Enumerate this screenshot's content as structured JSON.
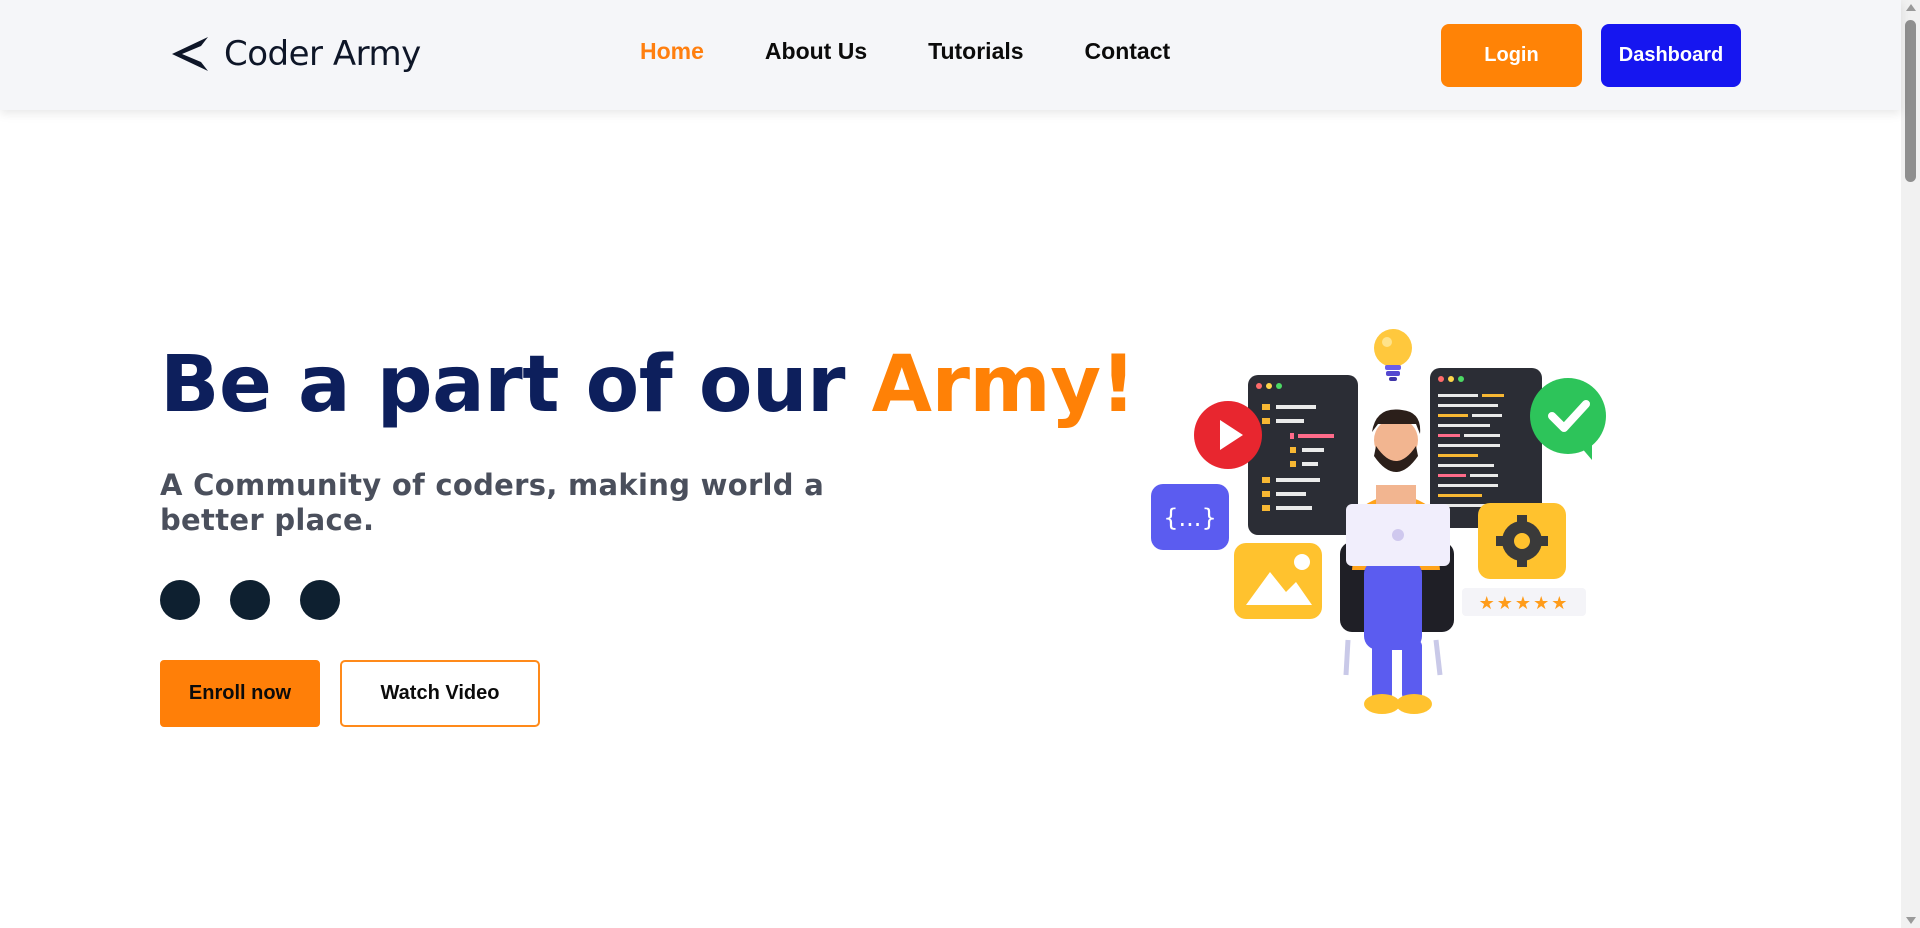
{
  "brand": {
    "name": "Coder Army",
    "logo_icon": "arrow-logo-icon"
  },
  "nav": {
    "links": [
      {
        "label": "Home",
        "active": true
      },
      {
        "label": "About Us",
        "active": false
      },
      {
        "label": "Tutorials",
        "active": false
      },
      {
        "label": "Contact",
        "active": false
      }
    ],
    "login_label": "Login",
    "dashboard_label": "Dashboard"
  },
  "hero": {
    "title_prefix": "Be a part of our ",
    "title_accent": "Army!",
    "subtitle": "A Community of coders, making world a better place.",
    "social_dots": 3,
    "enroll_label": "Enroll now",
    "watch_label": "Watch Video",
    "illustration": {
      "icons": [
        "lightbulb-icon",
        "play-icon",
        "checkmark-icon",
        "code-braces-icon",
        "image-icon",
        "gear-icon",
        "star-rating-icon",
        "laptop-icon"
      ],
      "code_badge_text": "{...}",
      "rating_stars": 5
    }
  },
  "colors": {
    "accent_orange": "#ff8106",
    "navy": "#0d1f5c",
    "dashboard_blue": "#1616f0",
    "dot_dark": "#0e2030"
  }
}
